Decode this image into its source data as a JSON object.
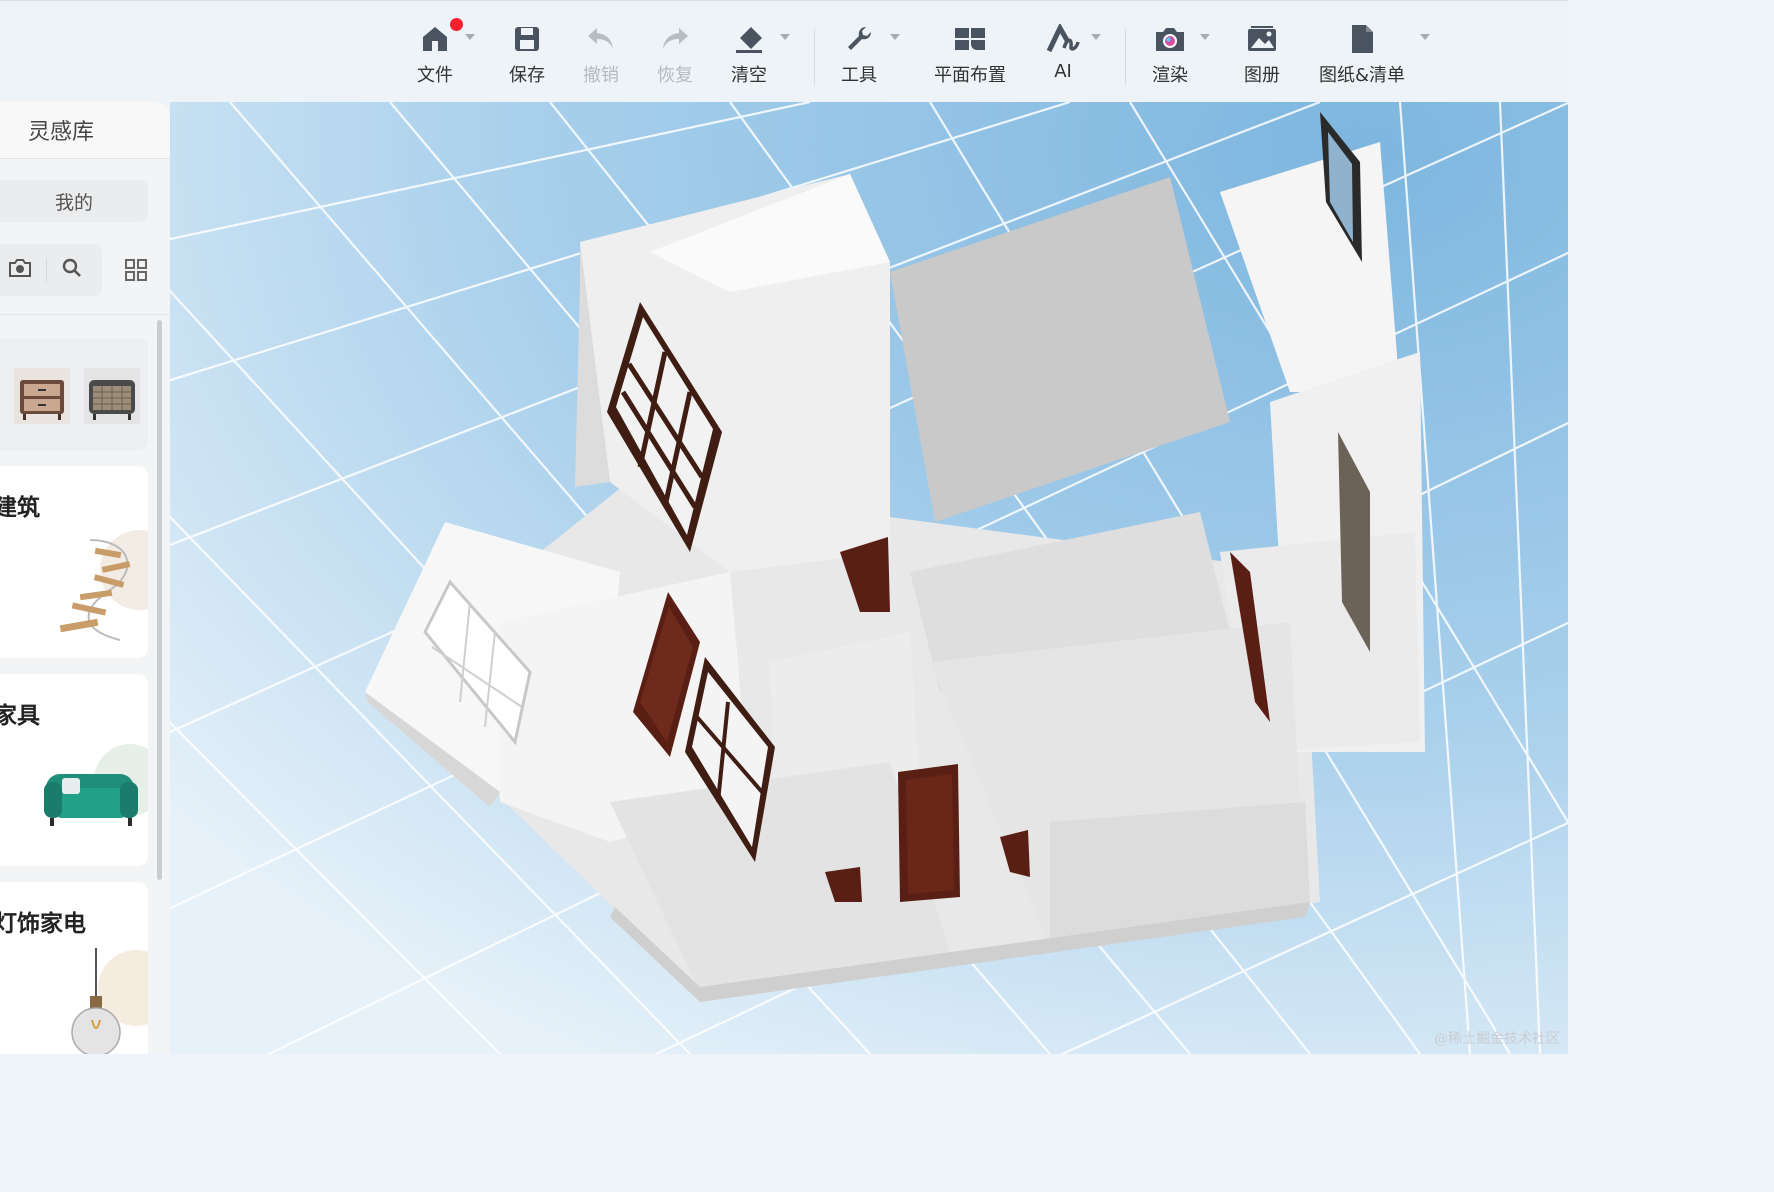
{
  "toolbar": {
    "items": [
      {
        "label": "文件",
        "icon": "home-file-icon",
        "badge": true
      },
      {
        "label": "保存",
        "icon": "save-icon"
      },
      {
        "label": "撤销",
        "icon": "undo-icon",
        "disabled": true
      },
      {
        "label": "恢复",
        "icon": "redo-icon",
        "disabled": true
      },
      {
        "label": "清空",
        "icon": "eraser-icon"
      },
      {
        "label": "工具",
        "icon": "wrench-icon"
      },
      {
        "label": "平面布置",
        "icon": "floor-plan-icon"
      },
      {
        "label": "AI",
        "icon": "ai-icon"
      },
      {
        "label": "渲染",
        "icon": "camera-render-icon"
      },
      {
        "label": "图册",
        "icon": "album-icon"
      },
      {
        "label": "图纸&清单",
        "icon": "document-icon"
      }
    ]
  },
  "panel": {
    "title": "灵感库",
    "mine_label": "我的",
    "categories": [
      {
        "title": "建筑",
        "image": "spiral-staircase"
      },
      {
        "title": "家具",
        "image": "green-armchair"
      },
      {
        "title": "灯饰家电",
        "image": "pendant-bulb-lamp"
      }
    ],
    "recent_items": [
      "nightstand-brown",
      "nightstand-rattan"
    ]
  },
  "colors": {
    "toolbar_bg": "#eef3f8",
    "sky": "#8ec2e6",
    "wall": "#f2f2f2",
    "door": "#5a1f14",
    "badge": "#f5222d"
  },
  "watermark": "@稀土掘金技术社区"
}
